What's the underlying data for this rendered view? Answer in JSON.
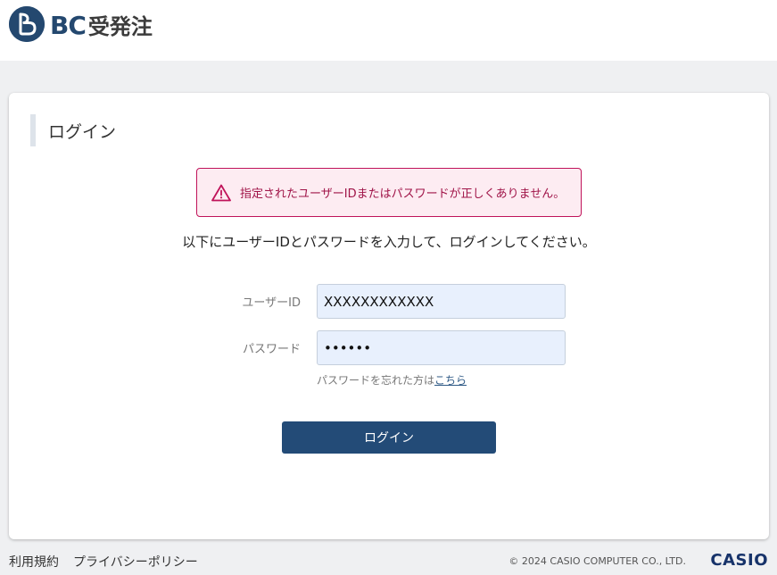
{
  "header": {
    "logo_bc": "BC",
    "logo_name": "受発注"
  },
  "card": {
    "title": "ログイン",
    "alert_text": "指定されたユーザーIDまたはパスワードが正しくありません。",
    "instruction": "以下にユーザーIDとパスワードを入力して、ログインしてください。",
    "user_id_label": "ユーザーID",
    "user_id_value": "XXXXXXXXXXXX",
    "password_label": "パスワード",
    "password_value": "••••••",
    "forgot_text": "パスワードを忘れた方は",
    "forgot_link": "こちら",
    "login_button": "ログイン"
  },
  "footer": {
    "terms": "利用規約",
    "privacy": "プライバシーポリシー",
    "copyright": "© 2024 CASIO COMPUTER CO., LTD.",
    "brand": "CASIO"
  },
  "colors": {
    "brand_navy": "#24486f",
    "alert_border": "#c0135a",
    "alert_bg": "#fdecf2",
    "input_bg": "#e8f0fd"
  },
  "icons": [
    "bc-logo-icon",
    "warning-icon"
  ]
}
